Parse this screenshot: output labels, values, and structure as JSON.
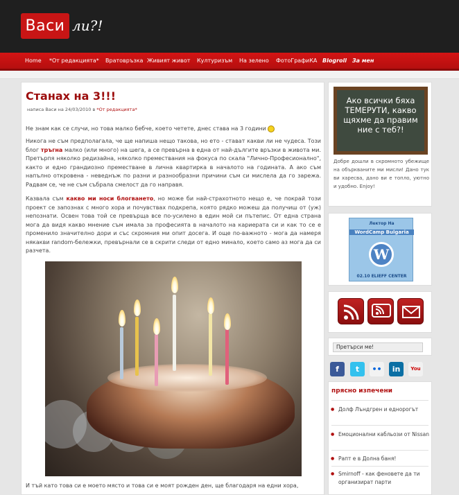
{
  "header": {
    "logo_main": "Васи",
    "logo_suffix": "ли?!"
  },
  "nav": {
    "items": [
      "Home",
      "*От редакцията*",
      "Вратовръзка",
      "Живият живот",
      "Културизъм",
      "На зелено",
      "ФотоГрафиКА",
      "Blogroll",
      "За мен"
    ]
  },
  "post": {
    "title": "Станах на 3!!!",
    "meta_prefix": "написа Васи на 24/03/2010 в ",
    "meta_category": "*От редакцията*",
    "p1": "Никога не съм предполагала, че ще напиша нещо такова, но ето - стават каквито ли не чудеса.",
    "p1_lead": "Не знам как се случи, но това малко бебче, което четете, днес става на 3 години",
    "p2_a": "Никога не съм предполагала, че ще напиша нещо такова, но ето - стават какви ли не чудеса. Този блог ",
    "p2_link": "тръгна",
    "p2_b": " малко (или много) на шега, а се превърна в една от най-дългите връзки в живота ми. Претърпя няколко редизайна, няколко премествания на фокуса по скала \"Лично-Професионално\", както и едно грандиозно преместване в лична квартирка в началото на годината. А ако съм напълно откровена - неведнъж по разни и разнообразни причини съм си мислела да го зарежа. Радвам се, че не съм събрала смелост да го направя.",
    "p3_a": "Казвала съм ",
    "p3_link": "какво ми носи блогването",
    "p3_b": ", но може би най-страхотното нещо е, че покрай този проект се запознах с много хора и почувствах подкрепа, която рядко можеш да получиш от (уж) непознати. Освен това той се превърща все по-усилено в един мой си пътепис. От една страна мога да видя какво мнение съм имала за професията в началото на кариерата си и как то се е променило значително дори и със скромния ми опит досега. И още по-важното - мога да намеря някакви random-бележки, превърнали се в скрити следи от едно минало, което само аз мога да си разчета.",
    "p4": "И тъй като това си е моето място и това си е моят рожден ден, ще благодаря на едни хора,"
  },
  "sidebar": {
    "chalk_text": "Ако всички бяха ТЕМЕРУТИ, какво щяхме да правим ние с теб?!",
    "about": "Добре дошли в скромното убежище на объркваните ми мисли! Дано тук ви харесва, дано ви е топло, уютно и удобно. Enjoy!",
    "wc_top": "Лектор На",
    "wc_brand": "WordCamp Bulgaria",
    "wc_bottom": "02.10  ELIEFF CENTER",
    "search_label": "Претърси ме!",
    "recent_title": "прясно изпечени",
    "recent": [
      "Долф Лъндгрен и еднорогът",
      "Емоционални кабльози от Nissan",
      "Рапт е в Долна баня!",
      "Smirnoff - как феновете да ти организират парти"
    ]
  },
  "colors": {
    "accent": "#b01010",
    "nav": "#c81515",
    "header": "#1f1f1f"
  }
}
